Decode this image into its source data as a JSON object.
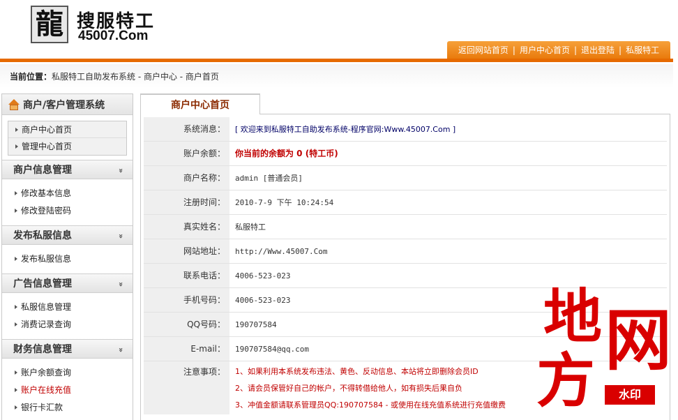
{
  "brand": {
    "logo_glyph": "龍",
    "title": "搜服特工",
    "url": "45007.Com"
  },
  "topnav": {
    "items": [
      "返回网站首页",
      "用户中心首页",
      "退出登陆",
      "私服特工"
    ],
    "separator": "|"
  },
  "breadcrumb": {
    "label": "当前位置：",
    "path": "私服特工自助发布系统 - 商户中心 - 商户首页"
  },
  "sidebar": {
    "title": "商户/客户管理系统",
    "top_links": [
      "商户中心首页",
      "管理中心首页"
    ],
    "sections": [
      {
        "title": "商户信息管理",
        "links": [
          "修改基本信息",
          "修改登陆密码"
        ]
      },
      {
        "title": "发布私服信息",
        "links": [
          "发布私服信息"
        ]
      },
      {
        "title": "广告信息管理",
        "links": [
          "私服信息管理",
          "消费记录查询"
        ]
      },
      {
        "title": "财务信息管理",
        "links": [
          "账户余额查询",
          "账户在线充值",
          "银行卡汇款"
        ]
      }
    ]
  },
  "main": {
    "tab": "商户中心首页",
    "rows": [
      {
        "label": "系统消息：",
        "value": "[ 欢迎来到私服特工自助发布系统-程序官网:Www.45007.Com ]"
      },
      {
        "label": "账户余额：",
        "value": "你当前的余额为 0 (特工币)"
      },
      {
        "label": "商户名称：",
        "value": "admin [普通会员]"
      },
      {
        "label": "注册时间：",
        "value": "2010-7-9 下午 10:24:54"
      },
      {
        "label": "真实姓名：",
        "value": "私服特工"
      },
      {
        "label": "网站地址：",
        "value": "http://Www.45007.Com"
      },
      {
        "label": "联系电话：",
        "value": "4006-523-023"
      },
      {
        "label": "手机号码：",
        "value": "4006-523-023"
      },
      {
        "label": "QQ号码：",
        "value": "190707584"
      },
      {
        "label": "E-mail：",
        "value": "190707584@qq.com"
      }
    ],
    "notes_label": "注意事项：",
    "notes": [
      "1、如果利用本系统发布违法、黄色、反动信息、本站将立即删除会员ID",
      "2、请会员保管好自己的帐户，不得转借给他人，如有损失后果自负",
      "3、冲值金额请联系管理员QQ:190707584 - 或使用在线充值系统进行充值缴费"
    ]
  },
  "watermark": {
    "chars": [
      "地",
      "网",
      "方"
    ],
    "stamp": "水印"
  },
  "colors": {
    "accent_orange": "#e66a00",
    "alert_red": "#c00000",
    "tab_text": "#8b2a00",
    "watermark_red": "#d90000"
  }
}
